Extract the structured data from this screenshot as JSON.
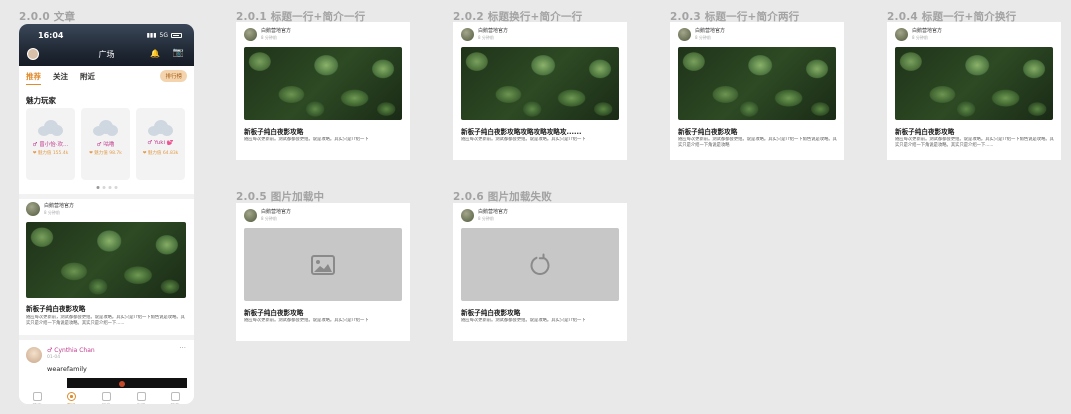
{
  "labels": {
    "s0": "2.0.0 文章",
    "s1": "2.0.1 标题一行+简介一行",
    "s2": "2.0.2 标题换行+简介一行",
    "s3": "2.0.3 标题一行+简介两行",
    "s4": "2.0.4 标题一行+简介换行",
    "s5": "2.0.5  图片加载中",
    "s6": "2.0.6 图片加载失败"
  },
  "phone": {
    "status_time": "16:04",
    "status_network": "5G",
    "header_title": "广场",
    "tabs": [
      "推荐",
      "关注",
      "附近"
    ],
    "rank_badge": "排行榜",
    "section_title": "魅力玩家",
    "players": [
      {
        "name": "♂ 曾小怡·欢…",
        "meta": "❤ 魅力值 155.4k"
      },
      {
        "name": "♂ 咕噜",
        "meta": "❤ 魅力值 98.7k"
      },
      {
        "name": "♂ Yuki 💕",
        "meta": "❤ 魅力值 64.83k"
      }
    ],
    "article": {
      "poster": "白鹅营地官方",
      "time": "8 分钟前",
      "title": "新板子纯白夜影攻略",
      "desc": "随应每次更新前，测试都都会更组。说是攻略。其实只是介绍一下角色说是攻略。其实只是介绍一下角说是攻略。其实只是介绍一下......"
    },
    "second_post": {
      "name": "♂ Cynthia Chan",
      "time": "01-04",
      "more": "···",
      "text": "wearefamily"
    },
    "tabbar": [
      "首页",
      "广场",
      "消息",
      "发现",
      "我的"
    ],
    "colors": {
      "accent": "#e08b2d",
      "female": "#c23c8e"
    }
  },
  "cards": {
    "poster": "白鹅营地官方",
    "time": "8 分钟前",
    "c1": {
      "title": "新板子纯白夜影攻略",
      "desc": "随应每次更新前。测试都都会更组。说是攻略。其实只是介绍一下"
    },
    "c2": {
      "title": "新板子纯白夜影攻略攻略攻略攻略攻......",
      "desc": "随应每次更新前。测试都都会更组。说是攻略。其实只是介绍一下"
    },
    "c3": {
      "title": "新板子纯白夜影攻略",
      "desc": "随应每次更新前。测试都都会更组。说是攻略。其实只是介绍一下角色说是攻略。其实只是介绍一下角说是攻略"
    },
    "c4": {
      "title": "新板子纯白夜影攻略",
      "desc": "随应每次更新前。测试都都会更组。说是攻略。其实只是介绍一下角色说是攻略。其实只是介绍一下角说是攻略。其实只是介绍一下......"
    },
    "c5": {
      "title": "新板子纯白夜影攻略",
      "desc": "随应每次更新前。测试都都会更组。说是攻略。其实只是介绍一下",
      "image_state": "image-placeholder-icon"
    },
    "c6": {
      "title": "新板子纯白夜影攻略",
      "desc": "随应每次更新前。测试都都会更组。说是攻略。其实只是介绍一下",
      "image_state": "reload-icon"
    }
  }
}
